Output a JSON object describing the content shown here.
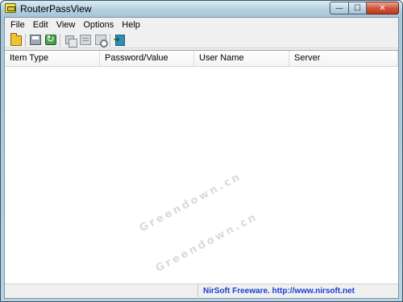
{
  "window": {
    "title": "RouterPassView",
    "controls": {
      "minimize": "—",
      "maximize": "☐",
      "close": "✕"
    }
  },
  "menu": [
    "File",
    "Edit",
    "View",
    "Options",
    "Help"
  ],
  "toolbar": {
    "icons": [
      "open-folder-icon",
      "save-icon",
      "refresh-icon",
      "copy-icon",
      "properties-icon",
      "find-icon",
      "exit-icon"
    ]
  },
  "list": {
    "columns": [
      "Item Type",
      "Password/Value",
      "User Name",
      "Server"
    ],
    "rows": []
  },
  "status": {
    "left_text": "",
    "right_text": "NirSoft Freeware.  http://www.nirsoft.net"
  },
  "watermark": [
    "Greendown.cn",
    "Greendown.cn"
  ],
  "colors": {
    "status_link": "#1a3fd1",
    "close_button": "#c0391f"
  }
}
